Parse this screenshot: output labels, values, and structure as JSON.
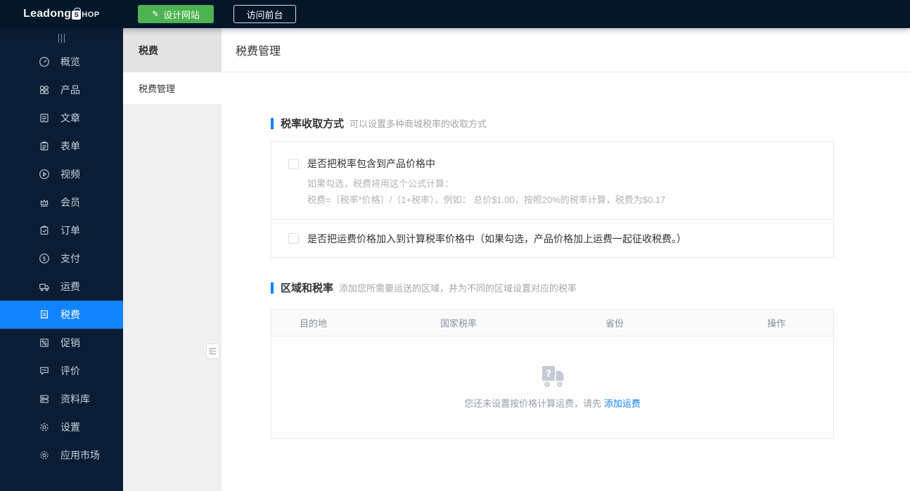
{
  "colors": {
    "accent": "#1283ff",
    "green": "#4db352",
    "dark": "#0b1d34"
  },
  "topbar": {
    "logo_left": "Leadong",
    "logo_bag_letter": "S",
    "logo_right": "HOP",
    "design_button": "设计网站",
    "visit_button": "访问前台"
  },
  "sidebar": {
    "items": [
      {
        "label": "概览",
        "icon": "overview-icon"
      },
      {
        "label": "产品",
        "icon": "products-icon"
      },
      {
        "label": "文章",
        "icon": "articles-icon"
      },
      {
        "label": "表单",
        "icon": "forms-icon"
      },
      {
        "label": "视频",
        "icon": "video-icon"
      },
      {
        "label": "会员",
        "icon": "members-icon"
      },
      {
        "label": "订单",
        "icon": "orders-icon"
      },
      {
        "label": "支付",
        "icon": "payments-icon"
      },
      {
        "label": "运费",
        "icon": "shipping-icon"
      },
      {
        "label": "税费",
        "icon": "tax-icon",
        "active": true
      },
      {
        "label": "促销",
        "icon": "promotions-icon"
      },
      {
        "label": "评价",
        "icon": "reviews-icon"
      },
      {
        "label": "资料库",
        "icon": "library-icon"
      },
      {
        "label": "设置",
        "icon": "settings-icon"
      },
      {
        "label": "应用市场",
        "icon": "app-market-icon"
      }
    ]
  },
  "submenu": {
    "title": "税费",
    "active_item": "税费管理"
  },
  "main": {
    "page_title": "税费管理",
    "section1": {
      "title": "税率收取方式",
      "subtitle": "可以设置多种商城税率的收取方式"
    },
    "checkbox1": {
      "checked": false,
      "label": "是否把税率包含到产品价格中",
      "note1": "如果勾选，税费将用这个公式计算：",
      "note2": "税费=（税率*价格）/（1+税率），例如： 总价$1.00，按照20%的税率计算，税费为$0.17"
    },
    "checkbox2": {
      "checked": false,
      "label": "是否把运费价格加入到计算税率价格中（如果勾选，产品价格加上运费一起征收税费。）"
    },
    "section2": {
      "title": "区域和税率",
      "subtitle": "添加您所需要运送的区域，并为不同的区域设置对应的税率"
    },
    "table": {
      "headers": [
        "目的地",
        "国家税率",
        "省份",
        "操作"
      ],
      "empty_text": "您还未设置按价格计算运费，请先",
      "empty_link": "添加运费"
    }
  }
}
